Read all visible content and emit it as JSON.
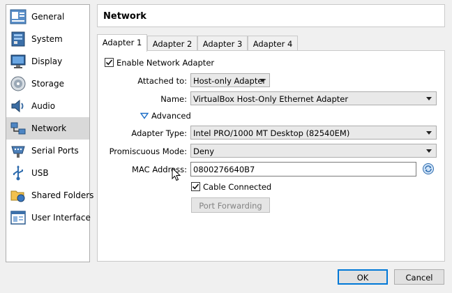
{
  "sidebar": {
    "items": [
      {
        "label": "General",
        "icon": "general-icon"
      },
      {
        "label": "System",
        "icon": "system-icon"
      },
      {
        "label": "Display",
        "icon": "display-icon"
      },
      {
        "label": "Storage",
        "icon": "storage-icon"
      },
      {
        "label": "Audio",
        "icon": "audio-icon"
      },
      {
        "label": "Network",
        "icon": "network-icon",
        "selected": true
      },
      {
        "label": "Serial Ports",
        "icon": "serial-ports-icon"
      },
      {
        "label": "USB",
        "icon": "usb-icon"
      },
      {
        "label": "Shared Folders",
        "icon": "shared-folders-icon"
      },
      {
        "label": "User Interface",
        "icon": "user-interface-icon"
      }
    ]
  },
  "header": {
    "title": "Network"
  },
  "tabs": [
    {
      "label": "Adapter 1",
      "active": true
    },
    {
      "label": "Adapter 2"
    },
    {
      "label": "Adapter 3"
    },
    {
      "label": "Adapter 4"
    }
  ],
  "adapter": {
    "enable_label": "Enable Network Adapter",
    "enable_checked": true,
    "attached_label": "Attached to:",
    "attached_value": "Host-only Adapter",
    "name_label": "Name:",
    "name_value": "VirtualBox Host-Only Ethernet Adapter",
    "advanced_label": "Advanced",
    "adapter_type_label": "Adapter Type:",
    "adapter_type_value": "Intel PRO/1000 MT Desktop (82540EM)",
    "promiscuous_label": "Promiscuous Mode:",
    "promiscuous_value": "Deny",
    "mac_label": "MAC Address:",
    "mac_value": "0800276640B7",
    "cable_label": "Cable Connected",
    "cable_checked": true,
    "port_forwarding_label": "Port Forwarding"
  },
  "footer": {
    "ok_label": "OK",
    "cancel_label": "Cancel"
  },
  "colors": {
    "accent": "#0078d7",
    "selected_bg": "#d9d9d9",
    "advanced_arrow": "#1c6ec7"
  }
}
